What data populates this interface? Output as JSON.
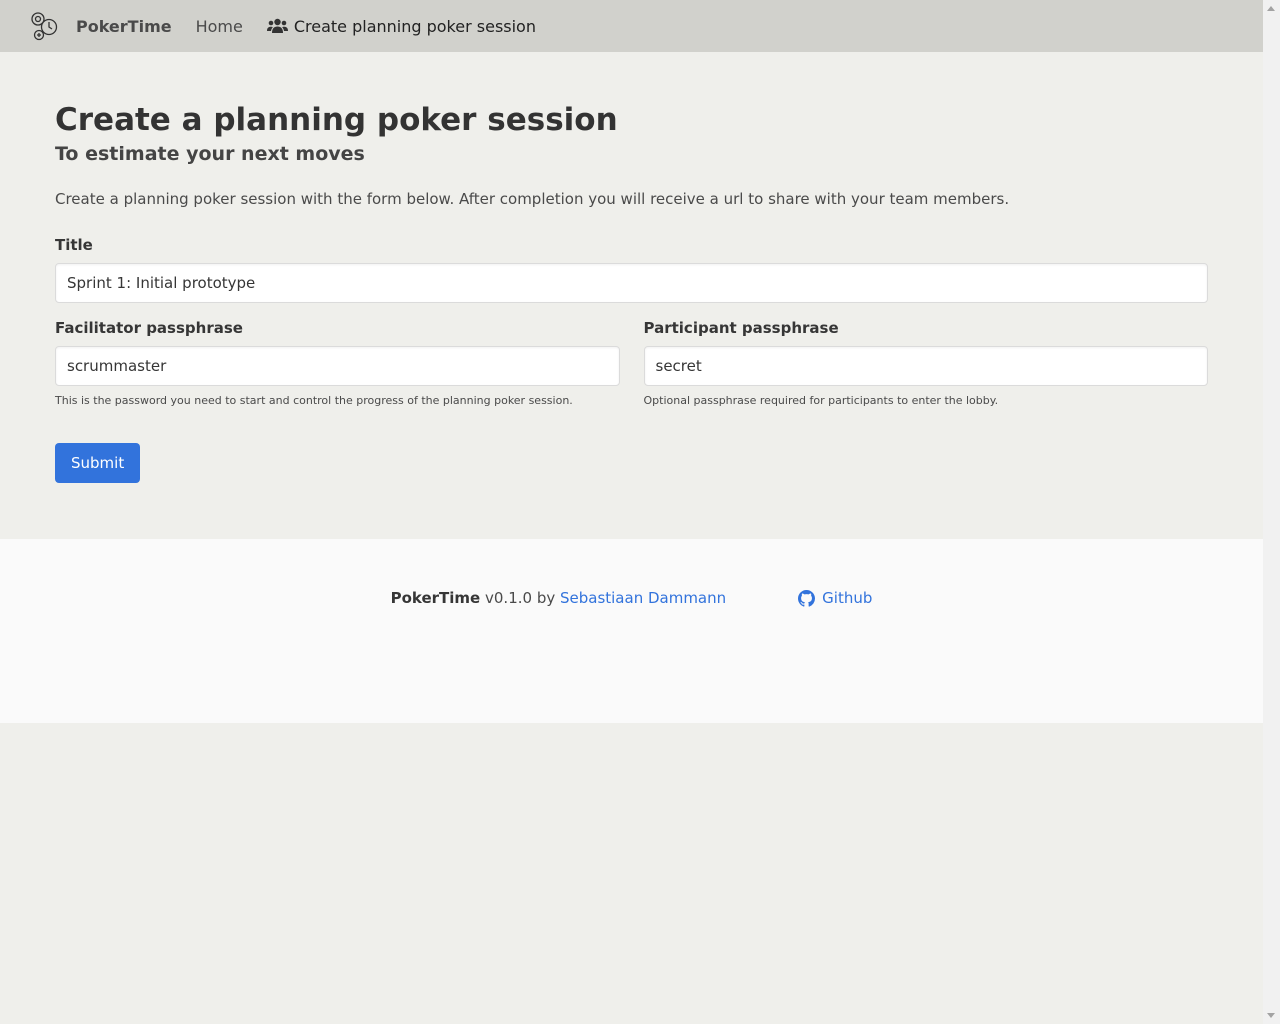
{
  "navbar": {
    "brand_name": "PokerTime",
    "logo_icon": "poker-time-logo-icon",
    "items": [
      {
        "label": "Home",
        "icon": null
      },
      {
        "label": "Create planning poker session",
        "icon": "users-icon"
      }
    ]
  },
  "main": {
    "title": "Create a planning poker session",
    "subtitle": "To estimate your next moves",
    "intro": "Create a planning poker session with the form below. After completion you will receive a url to share with your team members.",
    "form": {
      "title_label": "Title",
      "title_value": "Sprint 1: Initial prototype",
      "facilitator_label": "Facilitator passphrase",
      "facilitator_value": "scrummaster",
      "facilitator_help": "This is the password you need to start and control the progress of the planning poker session.",
      "participant_label": "Participant passphrase",
      "participant_value": "secret",
      "participant_help": "Optional passphrase required for participants to enter the lobby.",
      "submit_label": "Submit"
    }
  },
  "footer": {
    "app_name": "PokerTime",
    "version_text": " v0.1.0 by ",
    "author_link": "Sebastiaan Dammann",
    "github_label": "Github",
    "github_icon": "github-icon"
  },
  "colors": {
    "navbar_bg": "#d1d1cc",
    "page_bg": "#efefeb",
    "footer_bg": "#fafafa",
    "primary": "#3273dc",
    "link": "#3273dc"
  }
}
